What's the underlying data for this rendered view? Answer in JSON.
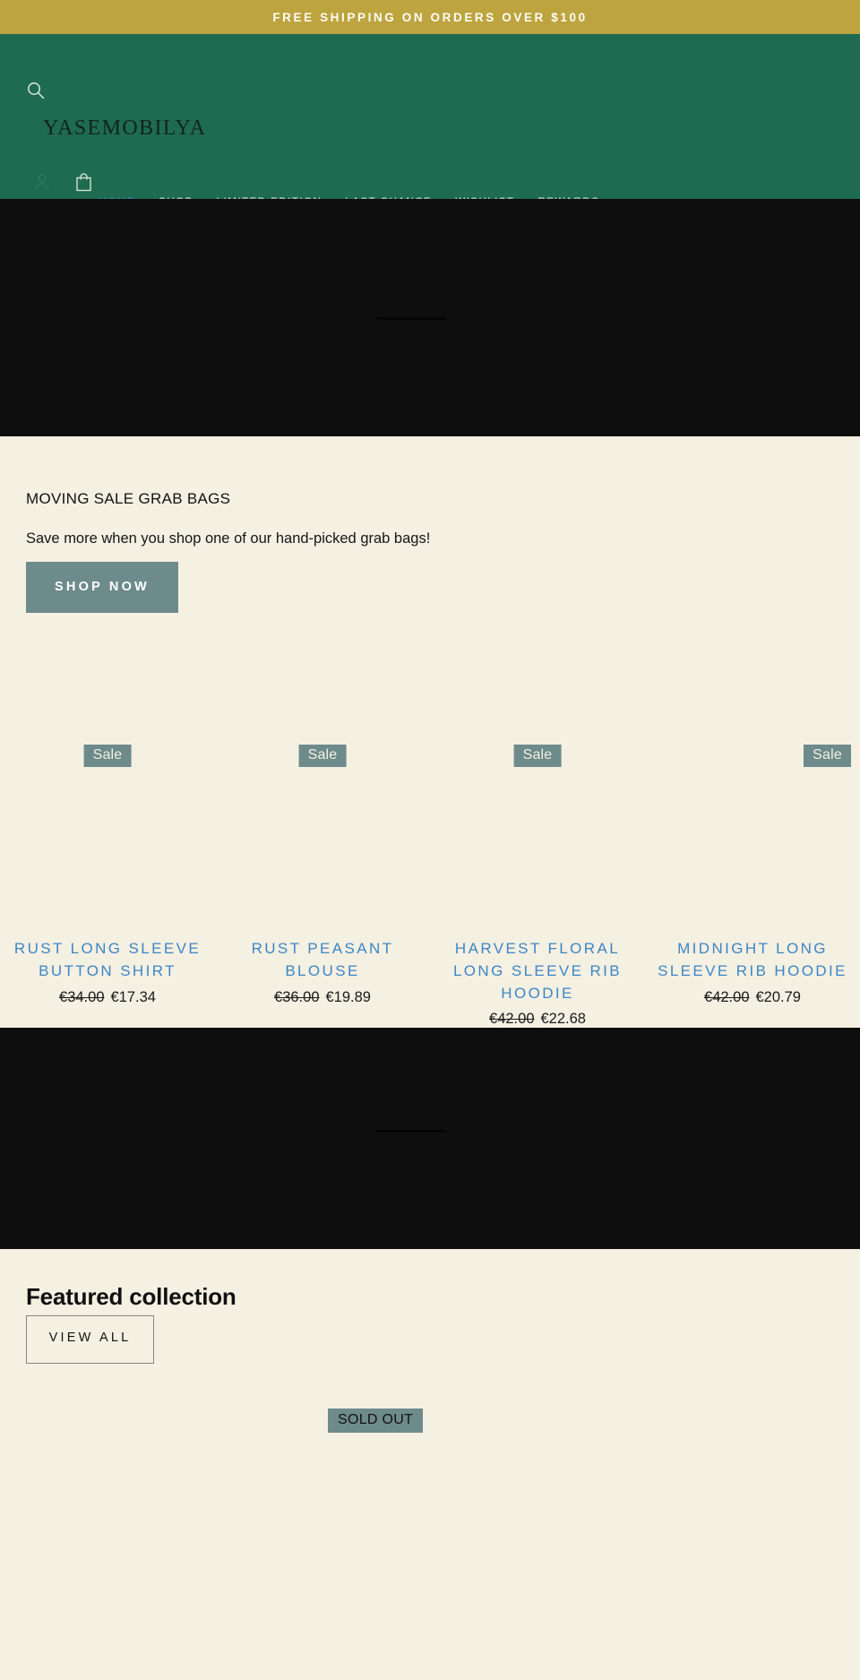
{
  "announcement": {
    "text": "FREE SHIPPING ON ORDERS OVER $100",
    "background": "#bda43f",
    "color": "#fdfdf8"
  },
  "header": {
    "background": "#1e6b51",
    "logo": "YASEMOBILYA",
    "search_icon": "search-icon",
    "account_icon": "account-icon",
    "cart_icon": "shopping-bag-icon",
    "nav": [
      {
        "label": "HOME",
        "active": true
      },
      {
        "label": "SHOP",
        "active": false
      },
      {
        "label": "LIMITED EDITION",
        "active": false
      },
      {
        "label": "LAST CHANCE",
        "active": false
      },
      {
        "label": "WISHLIST",
        "active": false
      },
      {
        "label": "REWARDS",
        "active": false
      }
    ],
    "active_color": "#3d86c6",
    "nav_color": "#e8ece6"
  },
  "hero_top": {
    "background": "#0e0e0e"
  },
  "promo": {
    "heading": "MOVING SALE GRAB BAGS",
    "subtext": "Save more when you shop one of our hand-picked grab bags!",
    "button_label": "SHOP NOW",
    "button_background": "#6e8b8b"
  },
  "products": [
    {
      "badge": "Sale",
      "title": "RUST LONG SLEEVE BUTTON SHIRT",
      "price_old": "€34.00",
      "price_new": "€17.34"
    },
    {
      "badge": "Sale",
      "title": "RUST PEASANT BLOUSE",
      "price_old": "€36.00",
      "price_new": "€19.89"
    },
    {
      "badge": "Sale",
      "title": "HARVEST FLORAL LONG SLEEVE RIB HOODIE",
      "price_old": "€42.00",
      "price_new": "€22.68"
    },
    {
      "badge": "Sale",
      "title": "MIDNIGHT LONG SLEEVE RIB HOODIE",
      "price_old": "€42.00",
      "price_new": "€20.79"
    }
  ],
  "product_title_color": "#3d86c6",
  "sale_badge_background": "#6e8b8b",
  "hero_bottom": {
    "background": "#0e0e0e"
  },
  "featured": {
    "heading": "Featured collection",
    "view_all_label": "VIEW ALL",
    "sold_out_label": "SOLD OUT"
  },
  "page_background": "#f4f0e2"
}
